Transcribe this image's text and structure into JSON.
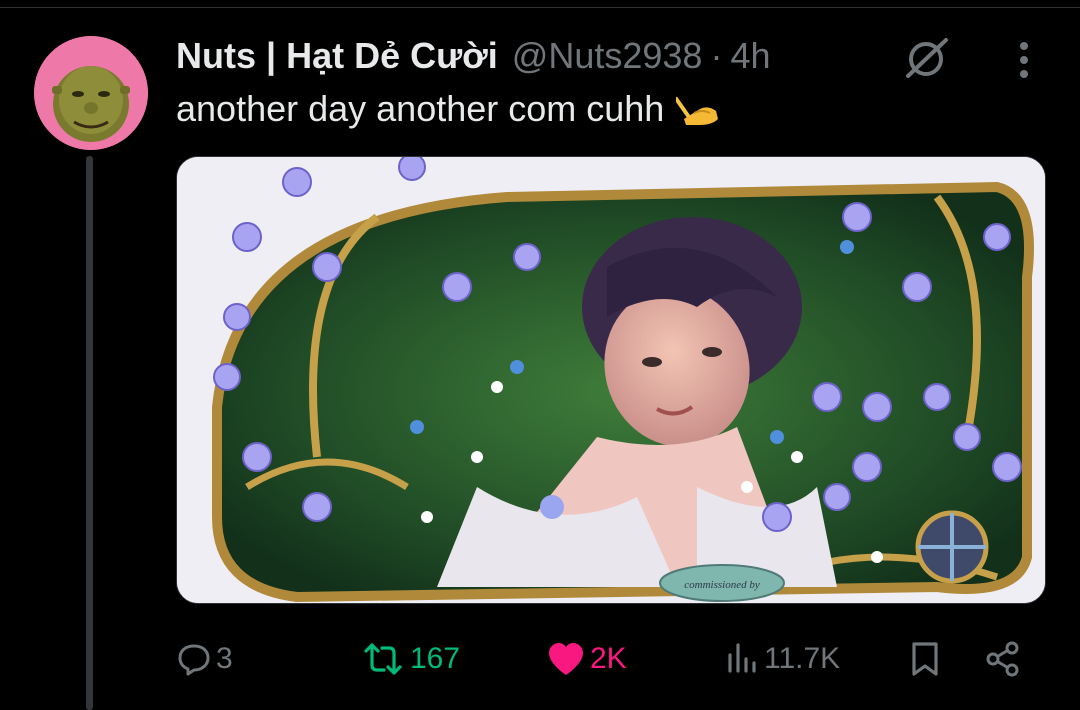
{
  "colors": {
    "background": "#000000",
    "primary_text": "#e7e9ea",
    "secondary_text": "#71767b",
    "retweet_active": "#00ba7c",
    "like_active": "#f91880",
    "avatar_bg": "#ee79a8",
    "divider": "#2f3336"
  },
  "author": {
    "display_name": "Nuts | Hạt Dẻ Cười",
    "handle": "@Nuts2938",
    "separator": "·",
    "time": "4h",
    "avatar_icon": "green-ogre-avatar"
  },
  "header_icons": {
    "grok": "grok-icon",
    "more": "more-options-icon"
  },
  "tweet": {
    "text": "another day another com cuhh",
    "emoji_icon": "writing-hand-icon"
  },
  "media": {
    "type": "illustration",
    "watermark": "commissioned by",
    "description_icon": "art-nouveau-flower-portrait"
  },
  "actions": {
    "replies": {
      "icon": "reply-icon",
      "count": "3"
    },
    "reposts": {
      "icon": "repost-icon",
      "count": "167",
      "active": true
    },
    "likes": {
      "icon": "heart-icon",
      "count": "2K",
      "active": true
    },
    "views": {
      "icon": "views-icon",
      "count": "11.7K"
    },
    "bookmark": {
      "icon": "bookmark-icon"
    },
    "share": {
      "icon": "share-icon"
    }
  }
}
